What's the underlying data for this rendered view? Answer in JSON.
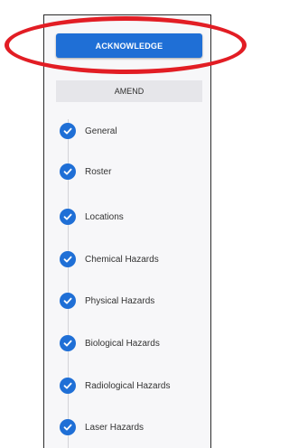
{
  "actions": {
    "acknowledge_label": "ACKNOWLEDGE",
    "amend_label": "AMEND"
  },
  "stepper": {
    "accent_color": "#1f6fd6",
    "completed_icon": "check-circle-icon",
    "steps": [
      {
        "label": "General"
      },
      {
        "label": "Roster"
      },
      {
        "label": "Locations"
      },
      {
        "label": "Chemical Hazards"
      },
      {
        "label": "Physical Hazards"
      },
      {
        "label": "Biological Hazards"
      },
      {
        "label": "Radiological Hazards"
      },
      {
        "label": "Laser Hazards"
      }
    ]
  },
  "annotation": {
    "highlight_color": "#e21d24"
  }
}
